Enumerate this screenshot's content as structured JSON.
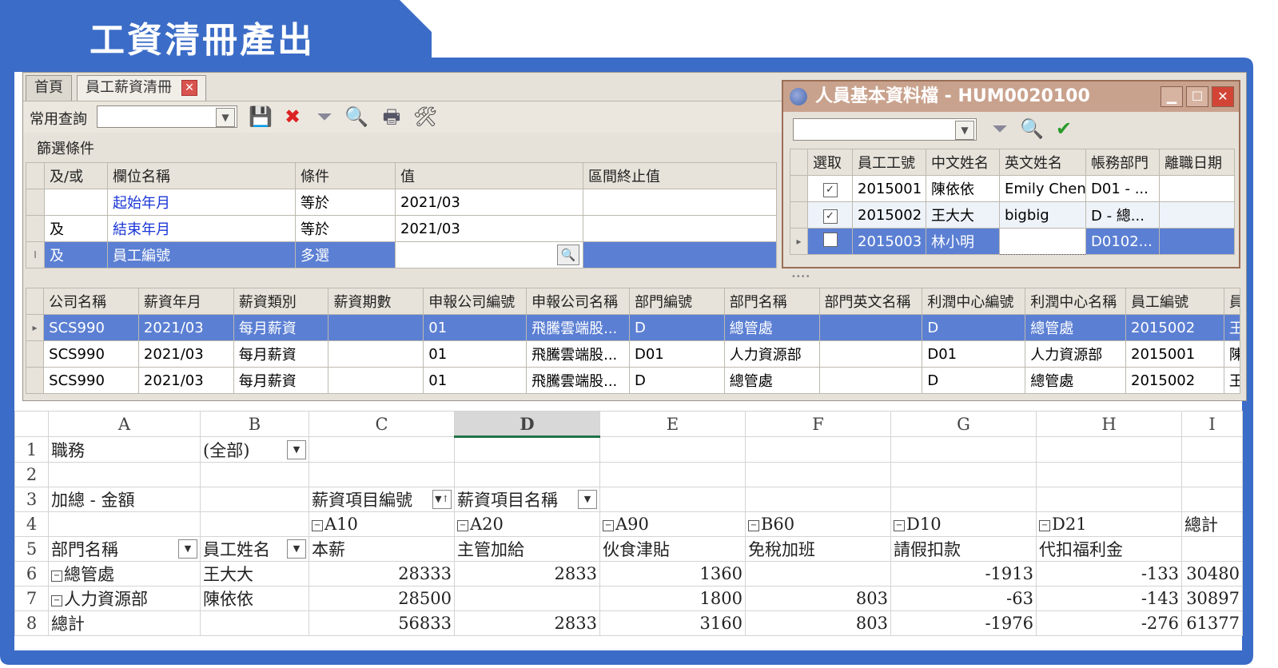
{
  "page_title": "工資清冊產出",
  "colors": {
    "frame": "#3b6cc7",
    "selection": "#5b7fd3",
    "excel_green": "#217346"
  },
  "tabs": [
    {
      "label": "首頁"
    },
    {
      "label": "員工薪資清冊"
    }
  ],
  "toolbar": {
    "query_label": "常用查詢",
    "query_value": "",
    "icons": [
      "save-icon",
      "delete-icon",
      "filter-icon",
      "search-icon",
      "print-icon",
      "tools-icon"
    ]
  },
  "filter": {
    "title": "篩選條件",
    "headers": [
      "及/或",
      "欄位名稱",
      "條件",
      "值",
      "區間終止值"
    ],
    "rows": [
      {
        "andor": "",
        "field": "起始年月",
        "cond": "等於",
        "value": "2021/03",
        "end": ""
      },
      {
        "andor": "及",
        "field": "結束年月",
        "cond": "等於",
        "value": "2021/03",
        "end": ""
      },
      {
        "andor": "及",
        "field": "員工編號",
        "cond": "多選",
        "value": "",
        "end": ""
      }
    ]
  },
  "popup": {
    "title": "人員基本資料檔 - HUM0020100",
    "headers": [
      "選取",
      "員工工號",
      "中文姓名",
      "英文姓名",
      "帳務部門",
      "離職日期"
    ],
    "rows": [
      {
        "checked": "✓",
        "id": "2015001",
        "cname": "陳依依",
        "ename": "Emily Chen",
        "dept": "D01 - ...",
        "leave": ""
      },
      {
        "checked": "✓",
        "id": "2015002",
        "cname": "王大大",
        "ename": "bigbig",
        "dept": "D - 總...",
        "leave": ""
      },
      {
        "checked": "",
        "id": "2015003",
        "cname": "林小明",
        "ename": "",
        "dept": "D0102...",
        "leave": ""
      }
    ]
  },
  "result": {
    "headers": [
      "公司名稱",
      "薪資年月",
      "薪資類別",
      "薪資期數",
      "申報公司編號",
      "申報公司名稱",
      "部門編號",
      "部門名稱",
      "部門英文名稱",
      "利潤中心編號",
      "利潤中心名稱",
      "員工編號",
      "員"
    ],
    "rows": [
      [
        "SCS990",
        "2021/03",
        "每月薪資",
        "",
        "01",
        "飛騰雲端股...",
        "D",
        "總管處",
        "",
        "D",
        "總管處",
        "2015002",
        "王"
      ],
      [
        "SCS990",
        "2021/03",
        "每月薪資",
        "",
        "01",
        "飛騰雲端股...",
        "D01",
        "人力資源部",
        "",
        "D01",
        "人力資源部",
        "2015001",
        "陳"
      ],
      [
        "SCS990",
        "2021/03",
        "每月薪資",
        "",
        "01",
        "飛騰雲端股...",
        "D",
        "總管處",
        "",
        "D",
        "總管處",
        "2015002",
        "王"
      ]
    ]
  },
  "sheet": {
    "col_headers": [
      "A",
      "B",
      "C",
      "D",
      "E",
      "F",
      "G",
      "H",
      "I"
    ],
    "row_headers": [
      "1",
      "2",
      "3",
      "4",
      "5",
      "6",
      "7",
      "8"
    ],
    "r1": {
      "a": "職務",
      "b": "(全部)"
    },
    "r3": {
      "a": "加總 - 金額",
      "c": "薪資項目編號",
      "d": "薪資項目名稱"
    },
    "r4": {
      "c": "A10",
      "d": "A20",
      "e": "A90",
      "f": "B60",
      "g": "D10",
      "h": "D21",
      "i": "總計"
    },
    "r5": {
      "a": "部門名稱",
      "b": "員工姓名",
      "c": "本薪",
      "d": "主管加給",
      "e": "伙食津貼",
      "f": "免稅加班",
      "g": "請假扣款",
      "h": "代扣福利金"
    },
    "r6": {
      "a": "總管處",
      "b": "王大大",
      "c": "28333",
      "d": "2833",
      "e": "1360",
      "f": "",
      "g": "-1913",
      "h": "-133",
      "i": "30480"
    },
    "r7": {
      "a": "人力資源部",
      "b": "陳依依",
      "c": "28500",
      "d": "",
      "e": "1800",
      "f": "803",
      "g": "-63",
      "h": "-143",
      "i": "30897"
    },
    "r8": {
      "a": "總計",
      "c": "56833",
      "d": "2833",
      "e": "3160",
      "f": "803",
      "g": "-1976",
      "h": "-276",
      "i": "61377"
    }
  }
}
